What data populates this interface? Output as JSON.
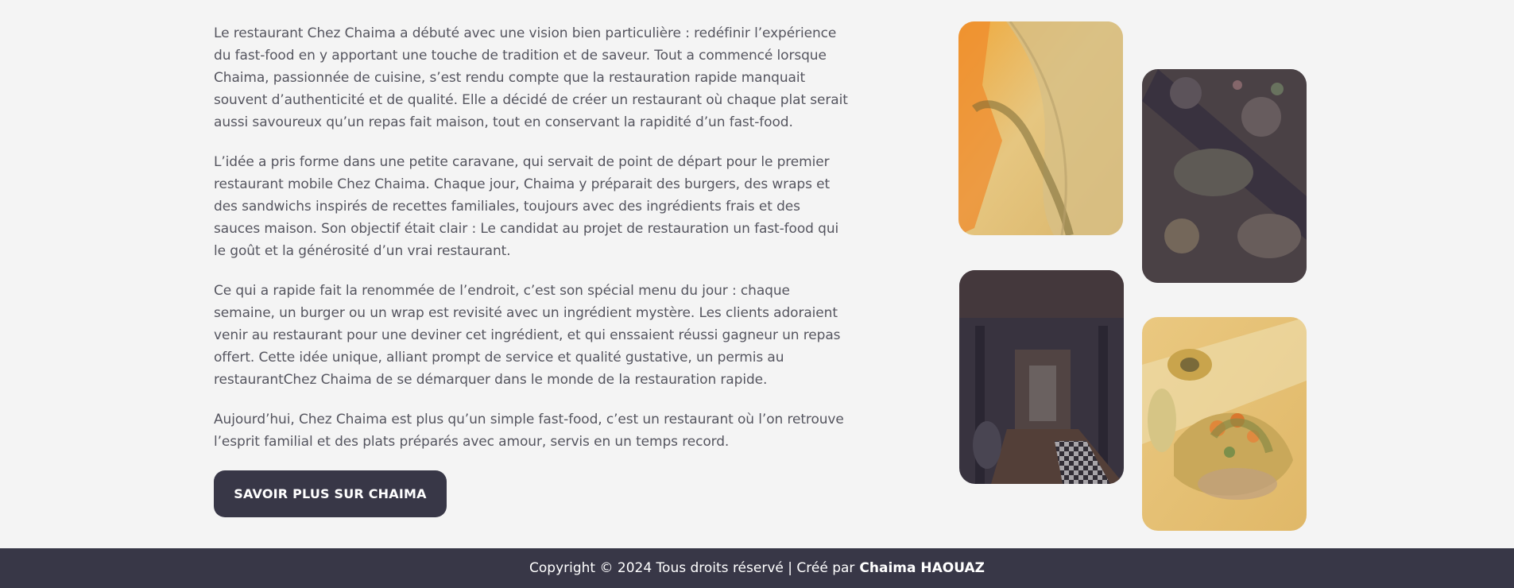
{
  "about": {
    "paragraphs": [
      "Le restaurant Chez Chaima a débuté avec une vision bien particulière : redéfinir l’expérience du fast-food en y apportant une touche de tradition et de saveur. Tout a commencé lorsque Chaima, passionnée de cuisine, s’est rendu compte que la restauration rapide manquait souvent d’authenticité et de qualité. Elle a décidé de créer un restaurant où chaque plat serait aussi savoureux qu’un repas fait maison, tout en conservant la rapidité d’un fast-food.",
      "L’idée a pris forme dans une petite caravane, qui servait de point de départ pour le premier restaurant mobile Chez Chaima. Chaque jour, Chaima y préparait des burgers, des wraps et des sandwichs inspirés de recettes familiales, toujours avec des ingrédients frais et des sauces maison. Son objectif était clair : Le candidat au projet de restauration un fast-food qui le goût et la générosité d’un vrai restaurant.",
      "Ce qui a rapide fait la renommée de l’endroit, c’est son spécial menu du jour : chaque semaine, un burger ou un wrap est revisité avec un ingrédient mystère. Les clients adoraient venir au restaurant pour une deviner cet ingrédient, et qui enssaient réussi gagneur un repas offert. Cette idée unique, alliant prompt de service et qualité gustative, un permis au restaurantChez Chaima de se démarquer dans le monde de la restauration rapide.",
      "Aujourd’hui, Chez Chaima est plus qu’un simple fast-food, c’est un restaurant où l’on retrouve l’esprit familial et des plats préparés avec amour, servis en un temps record."
    ],
    "cta_label": "SAVOIR PLUS SUR CHAIMA"
  },
  "gallery": {
    "photos": [
      {
        "name": "grilled-meat-flames-photo"
      },
      {
        "name": "food-platter-table-photo"
      },
      {
        "name": "restaurant-interior-photo"
      },
      {
        "name": "salad-plate-photo"
      }
    ]
  },
  "footer": {
    "copyright": "Copyright © 2024 Tous droits réservé | Créé par",
    "author": "Chaima HAOUAZ"
  },
  "colors": {
    "background": "#f4f4f4",
    "text": "#55555f",
    "dark": "#383747",
    "button_text": "#ffffff"
  }
}
